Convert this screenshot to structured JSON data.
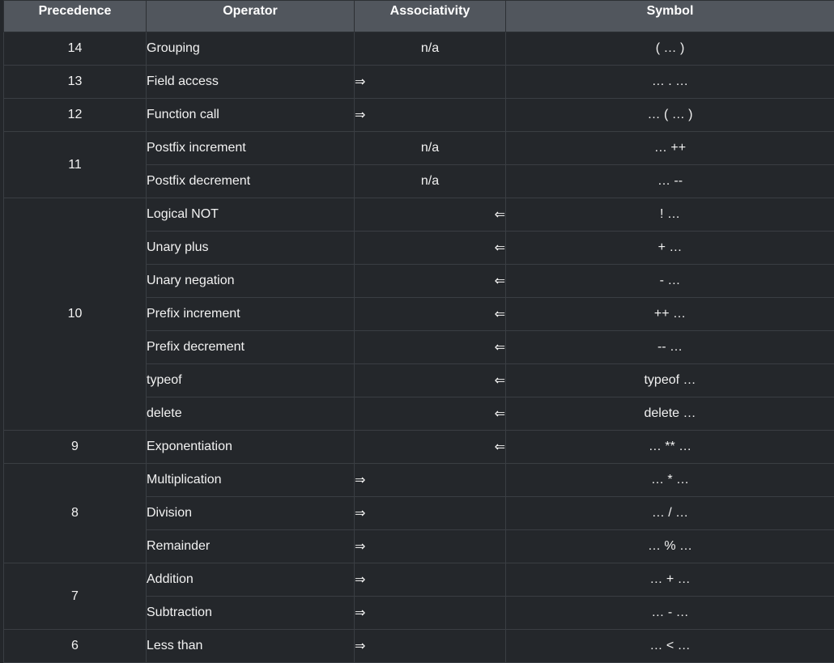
{
  "headers": [
    "Precedence",
    "Operator",
    "Associativity",
    "Symbol"
  ],
  "groups": [
    {
      "precedence": "14",
      "rows": [
        {
          "operator": "Grouping",
          "assoc": "n/a",
          "symbol": "( … )"
        }
      ]
    },
    {
      "precedence": "13",
      "rows": [
        {
          "operator": "Field access",
          "assoc": "⇒",
          "symbol": "… . …"
        }
      ]
    },
    {
      "precedence": "12",
      "rows": [
        {
          "operator": "Function call",
          "assoc": "⇒",
          "symbol": "… ( … )"
        }
      ]
    },
    {
      "precedence": "11",
      "rows": [
        {
          "operator": "Postfix increment",
          "assoc": "n/a",
          "symbol": "… ++"
        },
        {
          "operator": "Postfix decrement",
          "assoc": "n/a",
          "symbol": "… --"
        }
      ]
    },
    {
      "precedence": "10",
      "rows": [
        {
          "operator": "Logical NOT",
          "assoc": "⇐",
          "symbol": "! …"
        },
        {
          "operator": "Unary plus",
          "assoc": "⇐",
          "symbol": "+ …"
        },
        {
          "operator": "Unary negation",
          "assoc": "⇐",
          "symbol": "- …"
        },
        {
          "operator": "Prefix increment",
          "assoc": "⇐",
          "symbol": "++ …"
        },
        {
          "operator": "Prefix decrement",
          "assoc": "⇐",
          "symbol": "-- …"
        },
        {
          "operator": "typeof",
          "assoc": "⇐",
          "symbol": "typeof …"
        },
        {
          "operator": "delete",
          "assoc": "⇐",
          "symbol": "delete …"
        }
      ]
    },
    {
      "precedence": "9",
      "rows": [
        {
          "operator": "Exponentiation",
          "assoc": "⇐",
          "symbol": "… ** …"
        }
      ]
    },
    {
      "precedence": "8",
      "rows": [
        {
          "operator": "Multiplication",
          "assoc": "⇒",
          "symbol": "… * …"
        },
        {
          "operator": "Division",
          "assoc": "⇒",
          "symbol": "… / …"
        },
        {
          "operator": "Remainder",
          "assoc": "⇒",
          "symbol": "… % …"
        }
      ]
    },
    {
      "precedence": "7",
      "rows": [
        {
          "operator": "Addition",
          "assoc": "⇒",
          "symbol": "… + …"
        },
        {
          "operator": "Subtraction",
          "assoc": "⇒",
          "symbol": "… - …"
        }
      ]
    },
    {
      "precedence": "6",
      "rows": [
        {
          "operator": "Less than",
          "assoc": "⇒",
          "symbol": "… < …"
        }
      ]
    }
  ]
}
